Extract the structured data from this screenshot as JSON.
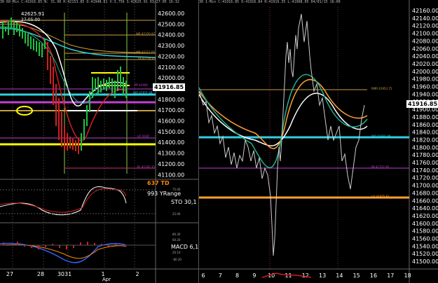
{
  "left": {
    "header": "30  60-Min  C:41916.85  N: 31.90  H:42153.85  O:41948.61  V:3,756  S:42625.91  03/27-05  16:32",
    "high_label": "42625.91",
    "high_sub": "27-05:00",
    "price_ticks": [
      "42600.00",
      "42500.00",
      "42400.00",
      "42300.00",
      "42200.00",
      "42100.00",
      "42000.00",
      "41900.00",
      "41800.00",
      "41700.00",
      "41600.00",
      "41500.00",
      "41400.00",
      "41300.00",
      "41200.00",
      "41100.00"
    ],
    "last_price": "41916.85",
    "level_labels": [
      "WR 42370.97",
      "WR 42212.66",
      "TH 42150.05",
      "PP 41909",
      "WO 41831.48",
      "LO 4140",
      "PL 41192.35"
    ],
    "ind_labels": [
      "637 TD",
      "993 YRange",
      "STO 30,1",
      "MACD 6,1"
    ],
    "sto_ticks": [
      "75.00",
      "25.00"
    ],
    "macd_ticks": [
      "80.30",
      "60.20",
      "20.10",
      "-80.30"
    ],
    "date_ticks": [
      "27",
      "28",
      "3031",
      "1",
      "2"
    ],
    "month_label": "Apr"
  },
  "right": {
    "header": "30  1-Min  C:41916.85  O:41916.84  H:41919.35  L:41908.05  04/01/15  16:00",
    "price_ticks": [
      "42160.00",
      "42140.00",
      "42120.00",
      "42100.00",
      "42080.00",
      "42060.00",
      "42040.00",
      "42020.00",
      "42000.00",
      "41980.00",
      "41960.00",
      "41940.00",
      "41920.00",
      "41900.00",
      "41880.00",
      "41860.00",
      "41840.00",
      "41820.00",
      "41800.00",
      "41780.00",
      "41760.00",
      "41740.00",
      "41720.00",
      "41700.00",
      "41680.00",
      "41660.00",
      "41640.00",
      "41620.00",
      "41600.00",
      "41580.00",
      "41560.00",
      "41540.00",
      "41520.00",
      "41500.00"
    ],
    "last_price": "41916.85",
    "level_labels": [
      "RMR 41953.75",
      "WO 41831.48",
      "PP 41752.95",
      "LO 41675.81"
    ],
    "time_ticks": [
      "6",
      "7",
      "8",
      "9",
      "10",
      "11",
      "12",
      "13",
      "14",
      "15",
      "16",
      "17",
      "18"
    ]
  },
  "colors": {
    "gold": "#c8a040",
    "yellow": "#ffff00",
    "cyan": "#30d0e0",
    "magenta": "#c040d0",
    "orange": "#ffa030",
    "teal": "#20b090",
    "green": "#20c040",
    "red": "#d02020"
  }
}
